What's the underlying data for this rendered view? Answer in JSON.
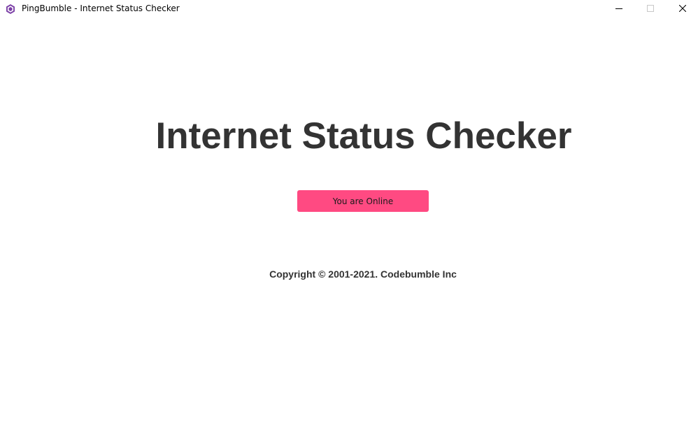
{
  "window": {
    "title": "PingBumble - Internet Status Checker",
    "app_icon": "hexagon-logo-icon",
    "controls": {
      "minimize_icon": "minimize-icon",
      "maximize_icon": "maximize-icon",
      "close_icon": "close-icon"
    }
  },
  "main": {
    "title": "Internet Status Checker",
    "status_button_label": "You are Online",
    "copyright": "Copyright © 2001-2021. Codebumble Inc"
  },
  "colors": {
    "status_button": "#ff4a82",
    "heading_text": "#333333",
    "app_icon": "#7b3fa6"
  }
}
